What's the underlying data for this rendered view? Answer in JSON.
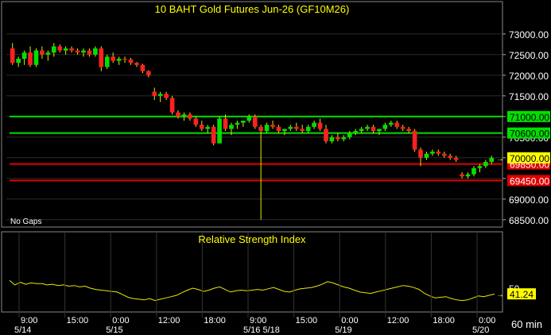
{
  "chart_data": [
    {
      "type": "candlestick",
      "title": "10 BAHT  Gold Futures Jun-26 (GF10M26)",
      "note": "No Gaps",
      "ylim": [
        68400,
        73400
      ],
      "y_ticks": [
        "73000.00",
        "72500.00",
        "72000.00",
        "71500.00",
        "71000.00",
        "70500.00",
        "70000.00",
        "69500.00",
        "69000.00",
        "68500.00"
      ],
      "y_tick_values": [
        73000,
        72500,
        72000,
        71500,
        71000,
        70500,
        70000,
        69500,
        69000,
        68500
      ],
      "horizontal_lines": [
        {
          "value": 71000,
          "label": "71000.00",
          "color": "#00e000"
        },
        {
          "value": 70600,
          "label": "70600.00",
          "color": "#00e000"
        },
        {
          "value": 69850,
          "label": "69850.00",
          "color": "#e00000"
        },
        {
          "value": 69450,
          "label": "69450.00",
          "color": "#e00000"
        }
      ],
      "last_price": {
        "value": 70000,
        "label": "70000.00"
      },
      "candles": [
        [
          72650,
          72780,
          72250,
          72300
        ],
        [
          72300,
          72450,
          72200,
          72400
        ],
        [
          72400,
          72600,
          72250,
          72550
        ],
        [
          72550,
          72700,
          72200,
          72250
        ],
        [
          72250,
          72650,
          72200,
          72600
        ],
        [
          72600,
          72700,
          72400,
          72500
        ],
        [
          72500,
          72600,
          72350,
          72550
        ],
        [
          72550,
          72780,
          72450,
          72700
        ],
        [
          72700,
          72750,
          72550,
          72600
        ],
        [
          72600,
          72700,
          72500,
          72650
        ],
        [
          72650,
          72700,
          72550,
          72600
        ],
        [
          72600,
          72650,
          72500,
          72550
        ],
        [
          72550,
          72650,
          72450,
          72600
        ],
        [
          72600,
          72650,
          72450,
          72500
        ],
        [
          72500,
          72700,
          72450,
          72650
        ],
        [
          72650,
          72700,
          72100,
          72200
        ],
        [
          72200,
          72500,
          72150,
          72450
        ],
        [
          72450,
          72550,
          72300,
          72350
        ],
        [
          72350,
          72450,
          72250,
          72400
        ],
        [
          72400,
          72450,
          72300,
          72380
        ],
        [
          72380,
          72420,
          72250,
          72300
        ],
        [
          72300,
          72320,
          72200,
          72250
        ],
        [
          72250,
          72280,
          72050,
          72100
        ],
        [
          72100,
          72120,
          71950,
          72000
        ],
        [
          71600,
          71700,
          71400,
          71500
        ],
        [
          71500,
          71600,
          71350,
          71550
        ],
        [
          71550,
          71600,
          71400,
          71450
        ],
        [
          71450,
          71500,
          71050,
          71100
        ],
        [
          71100,
          71150,
          70950,
          71000
        ],
        [
          71000,
          71100,
          70900,
          71050
        ],
        [
          71050,
          71100,
          70900,
          70950
        ],
        [
          70950,
          71000,
          70750,
          70800
        ],
        [
          70800,
          70900,
          70650,
          70700
        ],
        [
          70700,
          70800,
          70600,
          70750
        ],
        [
          70750,
          70800,
          70300,
          70350
        ],
        [
          70350,
          71000,
          70350,
          70950
        ],
        [
          70950,
          71050,
          70650,
          70700
        ],
        [
          70700,
          70850,
          70550,
          70800
        ],
        [
          70800,
          70900,
          70700,
          70850
        ],
        [
          70850,
          70900,
          70750,
          70900
        ],
        [
          70900,
          71050,
          70850,
          71000
        ],
        [
          71000,
          71050,
          70700,
          70750
        ],
        [
          70750,
          70800,
          68500,
          70650
        ],
        [
          70650,
          70850,
          70600,
          70800
        ],
        [
          70800,
          70900,
          70700,
          70750
        ],
        [
          70750,
          70800,
          70600,
          70650
        ],
        [
          70650,
          70700,
          70550,
          70700
        ],
        [
          70700,
          70800,
          70650,
          70750
        ],
        [
          70750,
          70850,
          70650,
          70700
        ],
        [
          70700,
          70800,
          70600,
          70650
        ],
        [
          70650,
          70800,
          70600,
          70750
        ],
        [
          70750,
          70900,
          70700,
          70850
        ],
        [
          70850,
          70950,
          70650,
          70700
        ],
        [
          70700,
          70800,
          70350,
          70400
        ],
        [
          70400,
          70550,
          70350,
          70500
        ],
        [
          70500,
          70600,
          70400,
          70450
        ],
        [
          70450,
          70550,
          70400,
          70500
        ],
        [
          70500,
          70650,
          70450,
          70600
        ],
        [
          70600,
          70700,
          70550,
          70650
        ],
        [
          70650,
          70750,
          70600,
          70700
        ],
        [
          70700,
          70800,
          70650,
          70750
        ],
        [
          70750,
          70800,
          70600,
          70650
        ],
        [
          70650,
          70700,
          70550,
          70700
        ],
        [
          70700,
          70850,
          70650,
          70800
        ],
        [
          70800,
          70900,
          70750,
          70850
        ],
        [
          70850,
          70900,
          70700,
          70750
        ],
        [
          70750,
          70800,
          70650,
          70700
        ],
        [
          70700,
          70750,
          70600,
          70650
        ],
        [
          70650,
          70700,
          70150,
          70200
        ],
        [
          70200,
          70250,
          69800,
          70000
        ],
        [
          70000,
          70150,
          69950,
          70100
        ],
        [
          70100,
          70200,
          70050,
          70150
        ],
        [
          70150,
          70200,
          70050,
          70100
        ],
        [
          70100,
          70150,
          70000,
          70050
        ],
        [
          70050,
          70100,
          69950,
          70000
        ],
        [
          70000,
          70050,
          69900,
          69950
        ],
        [
          69600,
          69650,
          69500,
          69550
        ],
        [
          69550,
          69650,
          69500,
          69600
        ],
        [
          69600,
          69800,
          69550,
          69750
        ],
        [
          69750,
          69850,
          69650,
          69800
        ],
        [
          69800,
          69950,
          69750,
          69900
        ],
        [
          69900,
          70050,
          69850,
          70000
        ]
      ],
      "volume_ticks": [
        {
          "label": "9:00",
          "date": "5/14"
        },
        {
          "label": "15:00"
        },
        {
          "label": "0:00",
          "date": "5/15"
        },
        {
          "label": "12:00"
        },
        {
          "label": "18:00"
        },
        {
          "label": "9:00",
          "date": "5/16|5/18"
        },
        {
          "label": "15:00"
        },
        {
          "label": "0:00",
          "date": "5/19"
        },
        {
          "label": "12:00"
        },
        {
          "label": "18:00"
        },
        {
          "label": "0:00",
          "date": "5/20"
        }
      ]
    },
    {
      "type": "line",
      "title": "Relative Strength Index",
      "ylim": [
        0,
        100
      ],
      "y_ticks": [
        "50"
      ],
      "y_tick_values": [
        50
      ],
      "last_value": {
        "value": 41.24,
        "label": "41.24"
      },
      "values": [
        62,
        55,
        59,
        56,
        58,
        57,
        57,
        55,
        56,
        54,
        55,
        53,
        54,
        52,
        53,
        50,
        48,
        47,
        46,
        45,
        44,
        40,
        36,
        34,
        33,
        32,
        34,
        31,
        33,
        35,
        37,
        39,
        43,
        47,
        50,
        48,
        45,
        47,
        50,
        52,
        48,
        44,
        46,
        47,
        46,
        47,
        48,
        47,
        49,
        51,
        48,
        45,
        44,
        47,
        49,
        50,
        51,
        53,
        56,
        60,
        58,
        55,
        52,
        50,
        47,
        44,
        43,
        42,
        44,
        46,
        48,
        50,
        52,
        54,
        53,
        51,
        48,
        42,
        38,
        35,
        36,
        37,
        34,
        32,
        31,
        32,
        35,
        38,
        37,
        39,
        41
      ]
    }
  ],
  "timeframe": "60 min"
}
